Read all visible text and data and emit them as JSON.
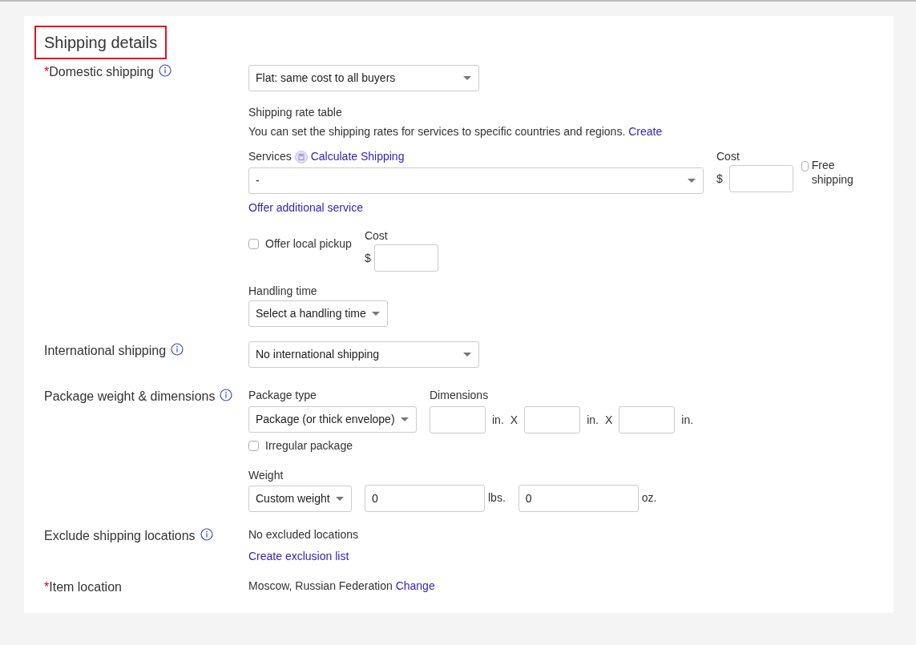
{
  "heading": {
    "text": "Shipping details",
    "highlighted": true
  },
  "sections": [
    {
      "kind": "domestic",
      "label": "Domestic shipping",
      "required_mark": "*",
      "info": true,
      "type_select": "Flat: same cost to all buyers",
      "rate_table": {
        "title": "Shipping rate table",
        "text": "You can set the shipping rates for services to specific countries and regions.",
        "link": "Create"
      },
      "services": {
        "label": "Services",
        "link": "Calculate Shipping",
        "value": "-",
        "cost_label": "Cost",
        "currency": "$",
        "free_label": "Free shipping",
        "free_checked": false
      },
      "offer_link": "Offer additional service",
      "pickup": {
        "label": "Offer local pickup",
        "checked": false,
        "cost_label": "Cost",
        "currency": "$"
      },
      "handling": {
        "label": "Handling time",
        "value": "Select a handling time"
      }
    },
    {
      "kind": "international",
      "label": "International shipping",
      "info": true,
      "value": "No international shipping"
    },
    {
      "kind": "package",
      "label": "Package weight & dimensions",
      "info": true,
      "type_label": "Package type",
      "type_value": "Package (or thick envelope)",
      "dims_label": "Dimensions",
      "dims": [
        {
          "unit": "in.",
          "separator": "X"
        },
        {
          "unit": "in.",
          "separator": "X"
        },
        {
          "unit": "in."
        }
      ],
      "irregular": {
        "label": "Irregular package",
        "checked": false
      },
      "weight": {
        "label": "Weight",
        "select": "Custom weight",
        "fields": [
          {
            "value": "0",
            "unit": "lbs."
          },
          {
            "value": "0",
            "unit": "oz."
          }
        ]
      }
    },
    {
      "kind": "exclude",
      "label": "Exclude shipping locations",
      "info": true,
      "text": "No excluded locations",
      "link": "Create exclusion list"
    },
    {
      "kind": "location",
      "label": "Item location",
      "required_mark": "*",
      "info": false,
      "text": "Moscow, Russian Federation",
      "link": "Change"
    }
  ]
}
